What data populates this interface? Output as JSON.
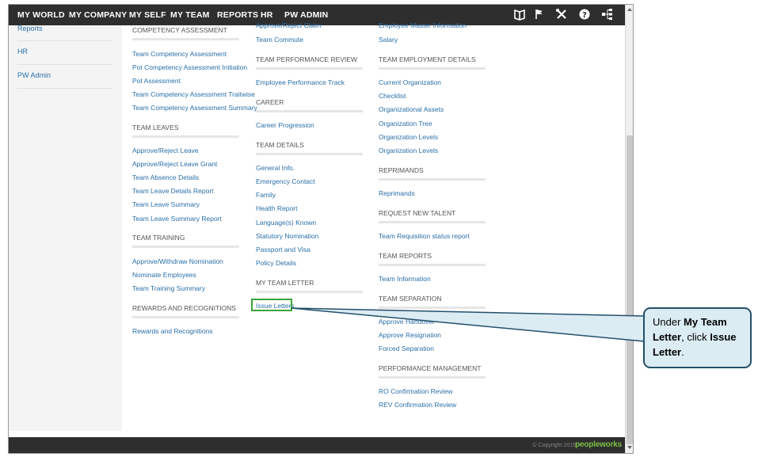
{
  "navbar": {
    "items": [
      "MY WORLD",
      "MY COMPANY",
      "MY SELF",
      "MY TEAM",
      "REPORTS",
      "HR",
      "PW ADMIN"
    ],
    "icons": [
      "book-icon",
      "flag-icon",
      "tools-icon",
      "help-icon",
      "sitemap-icon"
    ]
  },
  "left_menu": {
    "partial_top": "Reports",
    "items": [
      "HR",
      "PW Admin"
    ]
  },
  "columns": {
    "col1": {
      "sections": [
        {
          "title": "COMPETENCY ASSESSMENT",
          "links": [
            "Team Competency Assessment",
            "Pot Competency Assessment Initiation",
            "Pot Assessment",
            "Team Competency Assessment Traitwise",
            "Team Competency Assessment Summary"
          ]
        },
        {
          "title": "TEAM LEAVES",
          "links": [
            "Approve/Reject Leave",
            "Approve/Reject Leave Grant",
            "Team Absence Details",
            "Team Leave Details Report",
            "Team Leave Summary",
            "Team Leave Summary Report"
          ]
        },
        {
          "title": "TEAM TRAINING",
          "links": [
            "Approve/Withdraw Nomination",
            "Nominate Employees",
            "Team Training Summary"
          ]
        },
        {
          "title": "REWARDS AND RECOGNITIONS",
          "links": [
            "Rewards and Recognitions"
          ]
        }
      ]
    },
    "col2": {
      "partial_top": "Approve/Reject Claim",
      "top_links": [
        "Team Commute"
      ],
      "sections": [
        {
          "title": "TEAM PERFORMANCE REVIEW",
          "links": [
            "Employee Performance Track"
          ]
        },
        {
          "title": "CAREER",
          "links": [
            "Career Progression"
          ]
        },
        {
          "title": "TEAM DETAILS",
          "links": [
            "General Info.",
            "Emergency Contact",
            "Family",
            "Health Report",
            "Language(s) Known",
            "Statutory Nomination",
            "Passport and Visa",
            "Policy Details"
          ]
        },
        {
          "title": "MY TEAM LETTER",
          "links": [
            "Issue Letters"
          ]
        }
      ]
    },
    "col3": {
      "partial_top": "Employee Master Information",
      "top_links": [
        "Salary"
      ],
      "sections": [
        {
          "title": "TEAM EMPLOYMENT DETAILS",
          "links": [
            "Current Organization",
            "Checklist",
            "Organizational Assets",
            "Organization Tree",
            "Organization Levels",
            "Organization Levels"
          ]
        },
        {
          "title": "REPRIMANDS",
          "links": [
            "Reprimands"
          ]
        },
        {
          "title": "REQUEST NEW TALENT",
          "links": [
            "Team Requisition status report"
          ]
        },
        {
          "title": "TEAM REPORTS",
          "links": [
            "Team Information"
          ]
        },
        {
          "title": "TEAM SEPARATION",
          "links": [
            "Approve Handover",
            "Approve Resignation",
            "Forced Separation"
          ]
        },
        {
          "title": "PERFORMANCE MANAGEMENT",
          "links": [
            "RO Confirmation Review",
            "REV Confirmation Review"
          ]
        }
      ]
    }
  },
  "footer": {
    "copyright": "© Copyright 2015",
    "logo": "peopleworks"
  },
  "callout": {
    "prefix": "Under ",
    "bold1": "My Team Letter",
    "middle": ", click ",
    "bold2": "Issue Letter",
    "suffix": "."
  },
  "colors": {
    "nav_bg": "#2e2e2e",
    "link": "#2a6fa8",
    "highlight": "#3aa33a",
    "callout_bg": "#dcecf3",
    "callout_border": "#24506a"
  }
}
